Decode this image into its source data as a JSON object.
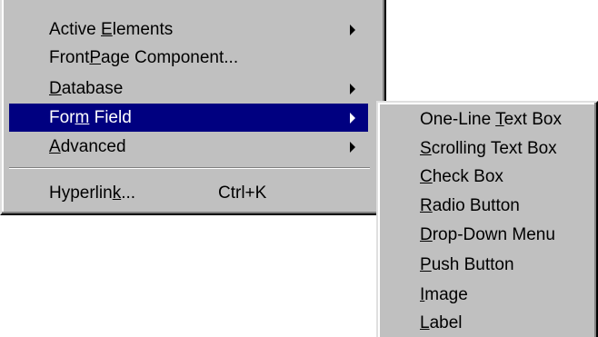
{
  "main_menu": {
    "items": [
      {
        "before": "Active ",
        "mnemonic": "E",
        "after": "lements",
        "has_submenu": true
      },
      {
        "before": "Front",
        "mnemonic": "P",
        "after": "age Component...",
        "has_submenu": false
      },
      {
        "before": "",
        "mnemonic": "D",
        "after": "atabase",
        "has_submenu": true
      },
      {
        "before": "For",
        "mnemonic": "m",
        "after": " Field",
        "has_submenu": true,
        "selected": true
      },
      {
        "before": "",
        "mnemonic": "A",
        "after": "dvanced",
        "has_submenu": true
      },
      {
        "before": "Hyperlin",
        "mnemonic": "k",
        "after": "...",
        "shortcut": "Ctrl+K",
        "has_submenu": false
      }
    ]
  },
  "submenu": {
    "items": [
      {
        "before": "One-Line ",
        "mnemonic": "T",
        "after": "ext Box"
      },
      {
        "before": "",
        "mnemonic": "S",
        "after": "crolling Text Box"
      },
      {
        "before": "",
        "mnemonic": "C",
        "after": "heck Box"
      },
      {
        "before": "",
        "mnemonic": "R",
        "after": "adio Button"
      },
      {
        "before": "",
        "mnemonic": "D",
        "after": "rop-Down Menu"
      },
      {
        "before": "",
        "mnemonic": "P",
        "after": "ush Button"
      },
      {
        "before": "",
        "mnemonic": "I",
        "after": "mage"
      },
      {
        "before": "",
        "mnemonic": "L",
        "after": "abel"
      }
    ]
  },
  "colors": {
    "menu_bg": "#c0c0c0",
    "selection_bg": "#000080",
    "selection_fg": "#ffffff"
  }
}
